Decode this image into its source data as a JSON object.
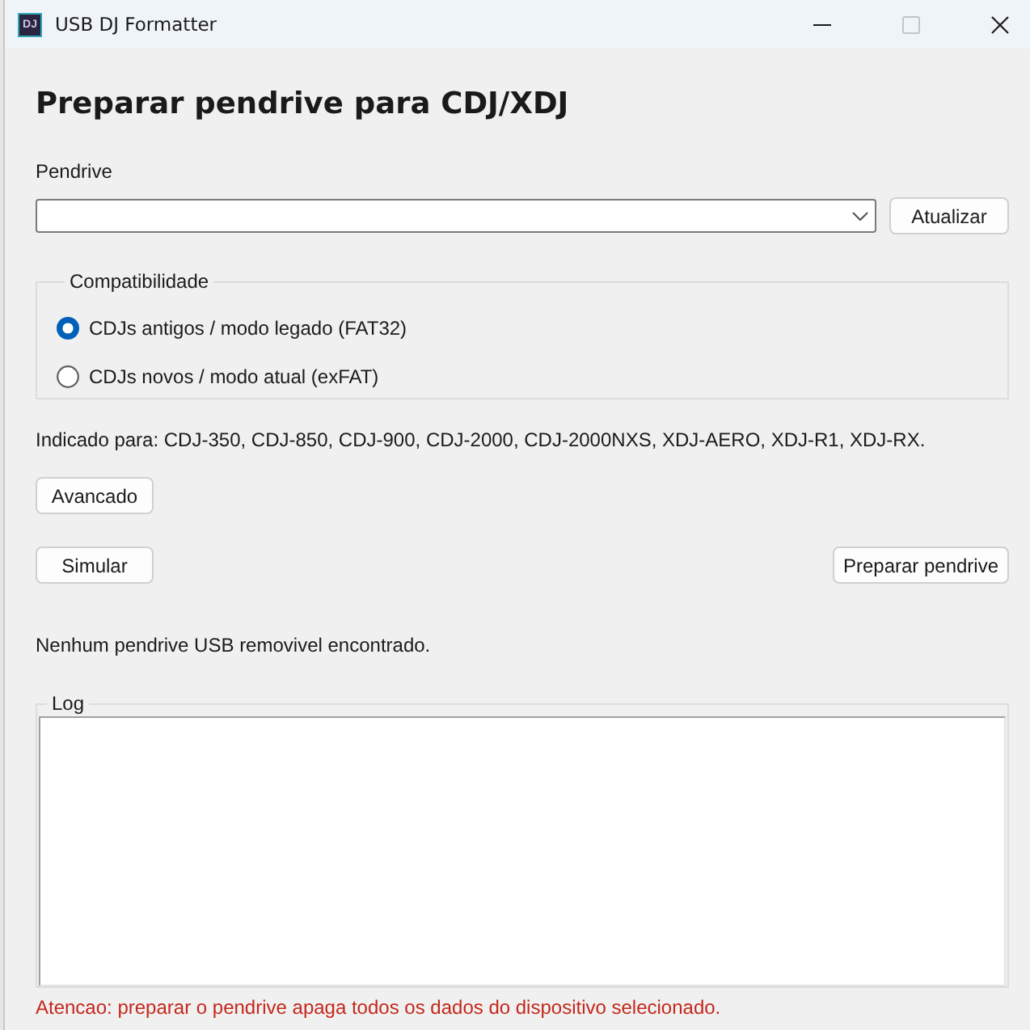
{
  "window": {
    "title": "USB DJ Formatter",
    "icon_text": "DJ",
    "maximize_disabled": true
  },
  "heading": "Preparar pendrive para CDJ/XDJ",
  "pendrive": {
    "label": "Pendrive",
    "refresh_button": "Atualizar"
  },
  "compatibility": {
    "title": "Compatibilidade",
    "options": [
      {
        "label": "CDJs antigos / modo legado (FAT32)",
        "selected": true
      },
      {
        "label": "CDJs novos / modo atual (exFAT)",
        "selected": false
      }
    ]
  },
  "supported_text": "Indicado para: CDJ-350, CDJ-850, CDJ-900, CDJ-2000, CDJ-2000NXS, XDJ-AERO, XDJ-R1, XDJ-RX.",
  "advanced_button": "Avancado",
  "actions": {
    "simulate_button": "Simular",
    "prepare_button": "Preparar pendrive"
  },
  "status_text": "Nenhum pendrive USB removivel encontrado.",
  "log": {
    "title": "Log"
  },
  "warning": "Atencao: preparar o pendrive apaga todos os dados do dispositivo selecionado."
}
